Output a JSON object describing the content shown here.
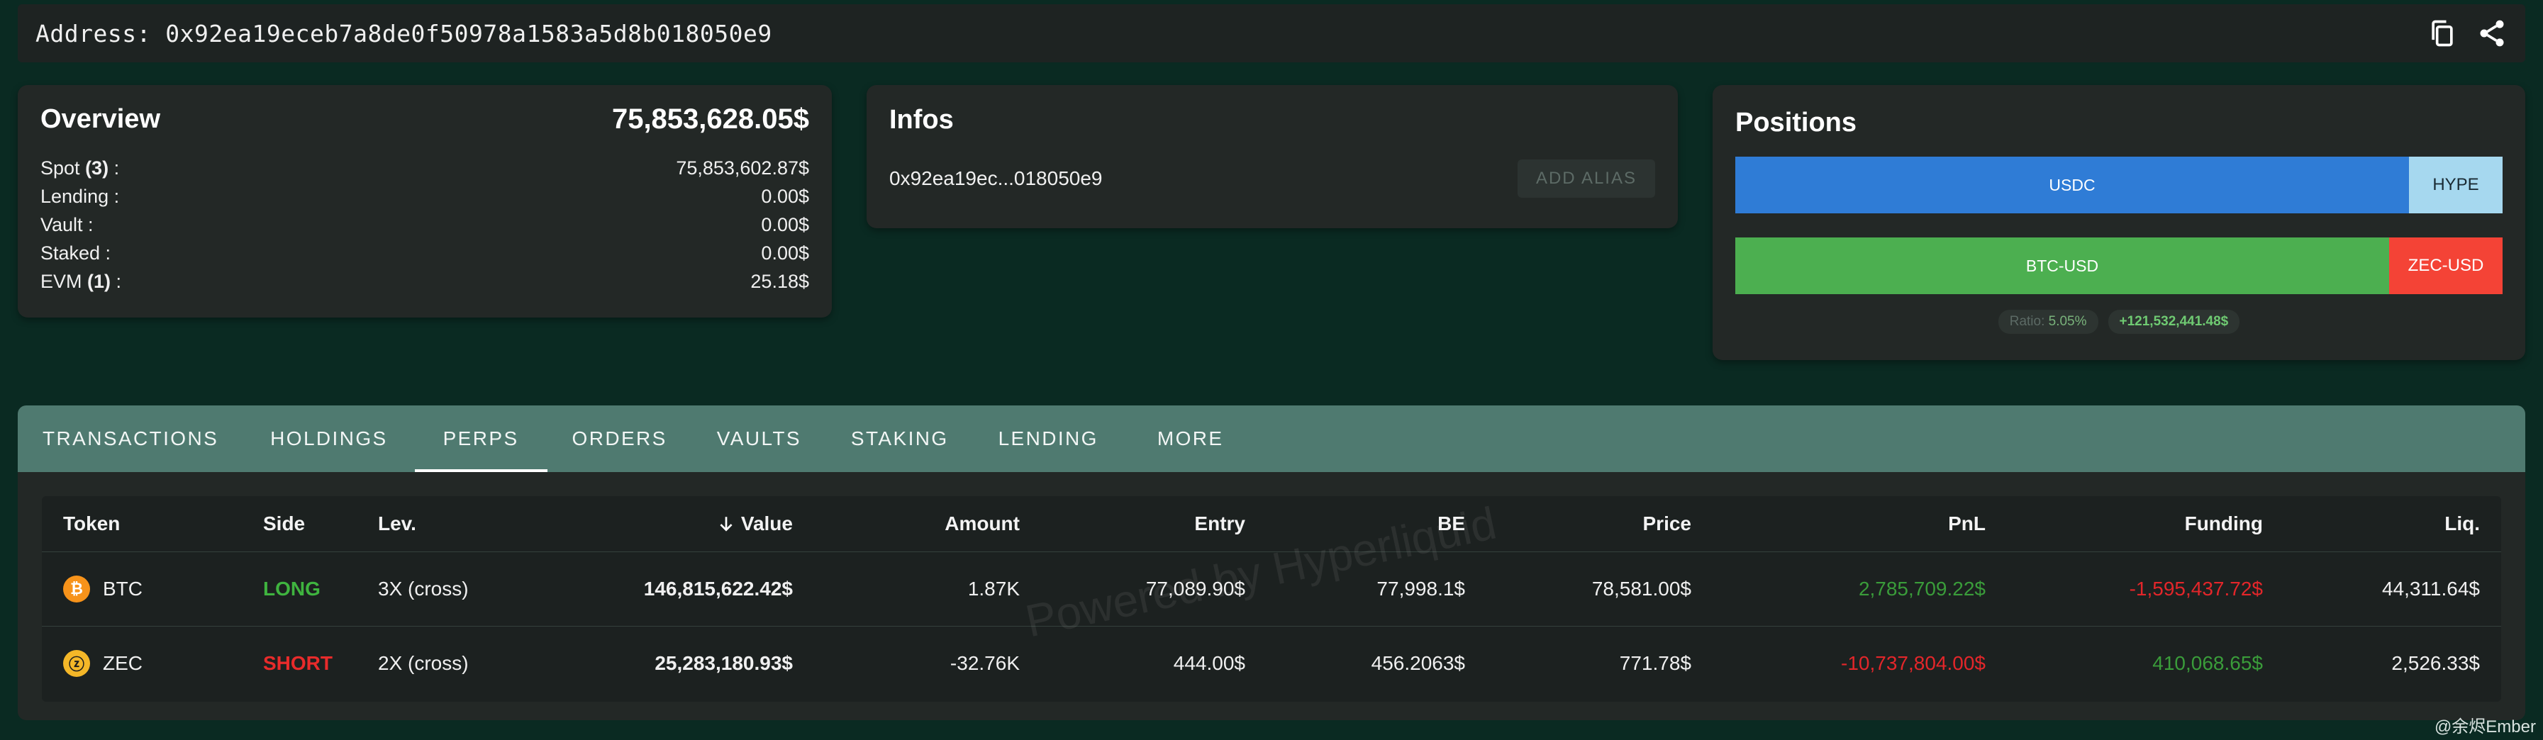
{
  "address_bar": {
    "label": "Address: 0x92ea19eceb7a8de0f50978a1583a5d8b018050e9",
    "icons": [
      "copy-icon",
      "share-icon"
    ]
  },
  "overview": {
    "title": "Overview",
    "total": "75,853,628.05$",
    "rows": [
      {
        "label": "Spot",
        "count": "(3)",
        "suffix": " :",
        "value": "75,853,602.87$"
      },
      {
        "label": "Lending :",
        "count": "",
        "suffix": "",
        "value": "0.00$"
      },
      {
        "label": "Vault :",
        "count": "",
        "suffix": "",
        "value": "0.00$"
      },
      {
        "label": "Staked :",
        "count": "",
        "suffix": "",
        "value": "0.00$"
      },
      {
        "label": "EVM",
        "count": "(1)",
        "suffix": " :",
        "value": "25.18$"
      }
    ]
  },
  "infos": {
    "title": "Infos",
    "short_address": "0x92ea19ec...018050e9",
    "add_alias_label": "ADD ALIAS"
  },
  "positions": {
    "title": "Positions",
    "bar1": [
      {
        "label": "USDC",
        "color": "#2f7cd6"
      },
      {
        "label": "HYPE",
        "color": "#a6d8ef"
      }
    ],
    "bar2": [
      {
        "label": "BTC-USD",
        "color": "#4caf50"
      },
      {
        "label": "ZEC-USD",
        "color": "#f44336"
      }
    ],
    "ratio_label": "Ratio:",
    "ratio_value": "5.05%",
    "pnl_badge": "+121,532,441.48$"
  },
  "tabs": [
    "TRANSACTIONS",
    "HOLDINGS",
    "PERPS",
    "ORDERS",
    "VAULTS",
    "STAKING",
    "LENDING",
    "MORE"
  ],
  "active_tab": "PERPS",
  "table": {
    "headers": [
      "Token",
      "Side",
      "Lev.",
      "Value",
      "Amount",
      "Entry",
      "BE",
      "Price",
      "PnL",
      "Funding",
      "Liq."
    ],
    "sort_icon": "arrow-down-icon",
    "rows": [
      {
        "token": "BTC",
        "side": "LONG",
        "lev": "3X (cross)",
        "value": "146,815,622.42$",
        "amount": "1.87K",
        "entry": "77,089.90$",
        "be": "77,998.1$",
        "price": "78,581.00$",
        "pnl": "2,785,709.22$",
        "funding": "-1,595,437.72$",
        "liq": "44,311.64$"
      },
      {
        "token": "ZEC",
        "side": "SHORT",
        "lev": "2X (cross)",
        "value": "25,283,180.93$",
        "amount": "-32.76K",
        "entry": "444.00$",
        "be": "456.2063$",
        "price": "771.78$",
        "pnl": "-10,737,804.00$",
        "funding": "410,068.65$",
        "liq": "2,526.33$"
      }
    ]
  },
  "watermark": "Powered by Hyperliquid",
  "credit": "@余烬Ember"
}
